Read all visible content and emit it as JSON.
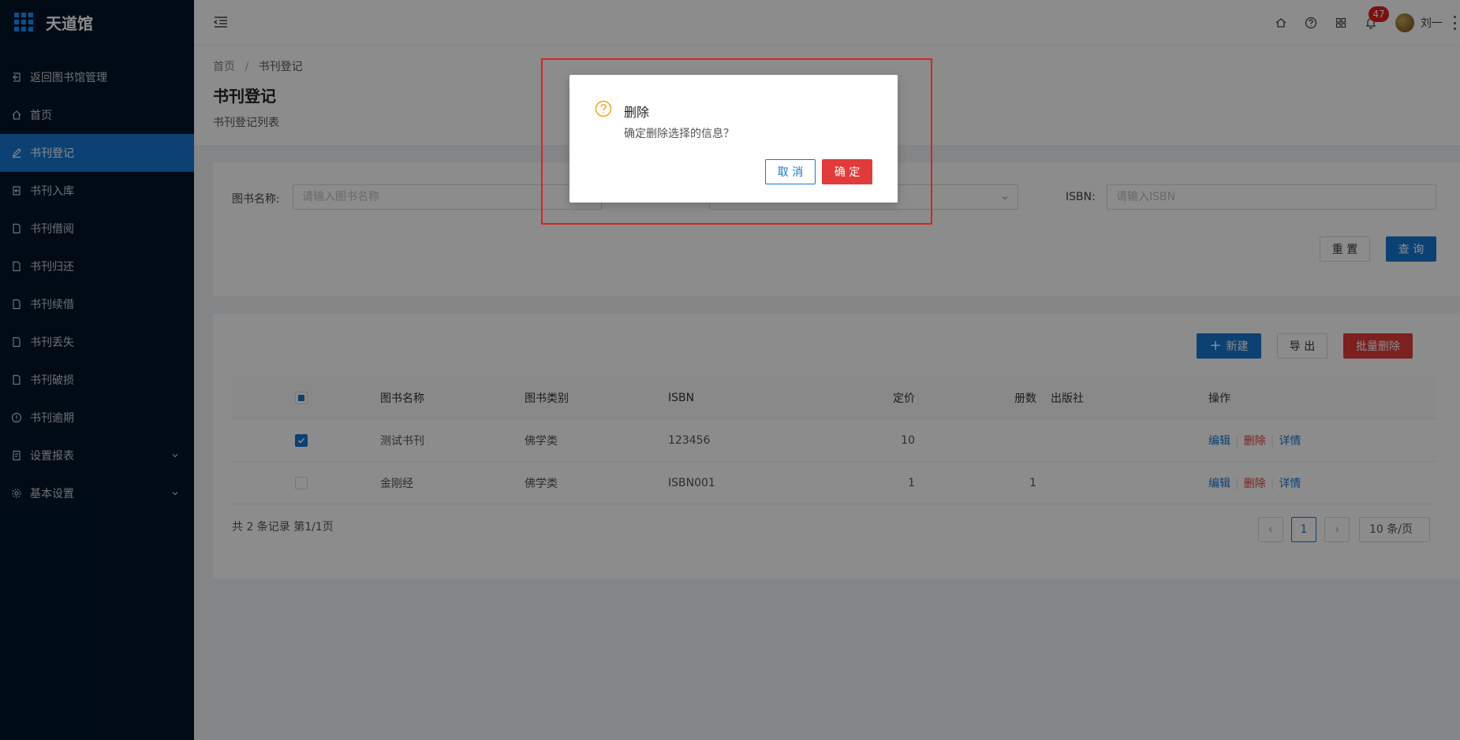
{
  "app": {
    "title": "天道馆"
  },
  "sidebar": {
    "items": [
      {
        "label": "返回图书馆管理",
        "icon": "back-icon"
      },
      {
        "label": "首页",
        "icon": "home-icon"
      },
      {
        "label": "书刊登记",
        "icon": "edit-icon",
        "active": true
      },
      {
        "label": "书刊入库",
        "icon": "import-icon"
      },
      {
        "label": "书刊借阅",
        "icon": "file-icon"
      },
      {
        "label": "书刊归还",
        "icon": "file-icon"
      },
      {
        "label": "书刊续借",
        "icon": "file-icon"
      },
      {
        "label": "书刊丢失",
        "icon": "file-icon"
      },
      {
        "label": "书刊破损",
        "icon": "file-icon"
      },
      {
        "label": "书刊逾期",
        "icon": "info-icon"
      },
      {
        "label": "设置报表",
        "icon": "report-icon",
        "expandable": true
      },
      {
        "label": "基本设置",
        "icon": "gear-icon",
        "expandable": true
      }
    ]
  },
  "header": {
    "notifications": "47",
    "username": "刘一"
  },
  "page": {
    "breadcrumb": [
      "首页",
      "/",
      "书刊登记"
    ],
    "title": "书刊登记",
    "description": "书刊登记列表"
  },
  "search": {
    "name_label": "图书名称:",
    "name_placeholder": "请输入图书名称",
    "isbn_label": "ISBN:",
    "isbn_placeholder": "请输入ISBN",
    "reset": "重 置",
    "query": "查 询"
  },
  "toolbar": {
    "new": "新建",
    "export": "导 出",
    "batch_delete": "批量删除"
  },
  "table": {
    "columns": [
      "图书名称",
      "图书类别",
      "ISBN",
      "定价",
      "册数",
      "出版社",
      "操作"
    ],
    "rows": [
      {
        "name": "测试书刊",
        "category": "佛学类",
        "isbn": "123456",
        "price": "10",
        "count": "",
        "publisher": "",
        "checked": true
      },
      {
        "name": "金刚经",
        "category": "佛学类",
        "isbn": "ISBN001",
        "price": "1",
        "count": "1",
        "publisher": "",
        "checked": false
      }
    ],
    "actions": {
      "edit": "编辑",
      "delete": "删除",
      "detail": "详情"
    }
  },
  "pagination": {
    "total": "共 2 条记录 第1/1页",
    "current": "1",
    "page_size": "10 条/页"
  },
  "modal": {
    "title": "删除",
    "content": "确定删除选择的信息？",
    "cancel": "取 消",
    "ok": "确 定"
  },
  "colors": {
    "sidebar_bg": "#001529",
    "primary": "#1677d2",
    "danger": "#e23b3b",
    "highlight": "#e02020"
  }
}
